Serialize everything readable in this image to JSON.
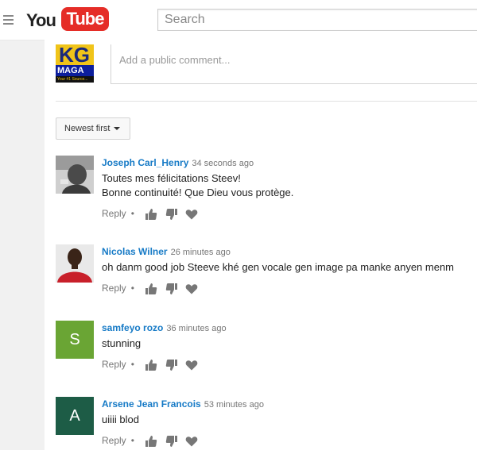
{
  "header": {
    "logo_you": "You",
    "logo_tube": "Tube",
    "search_placeholder": "Search"
  },
  "compose": {
    "avatar_big": "KG",
    "avatar_mid": "MAGA",
    "avatar_tag": "Your #1 Source...",
    "placeholder": "Add a public comment..."
  },
  "sort": {
    "label": "Newest first"
  },
  "comments": [
    {
      "author": "Joseph Carl_Henry",
      "time": "34 seconds ago",
      "text_line1": "Toutes mes félicitations Steev!",
      "text_line2": "Bonne continuité! Que Dieu vous protège.",
      "reply": "Reply",
      "avatar_color": "#9a9a9a"
    },
    {
      "author": "Nicolas Wilner",
      "time": "26 minutes ago",
      "text_line1": "oh danm good job Steeve khé gen vocale gen image pa manke anyen menm",
      "reply": "Reply",
      "avatar_color": "#c8202a"
    },
    {
      "author": "samfeyo rozo",
      "time": "36 minutes ago",
      "text_line1": "stunning",
      "reply": "Reply",
      "avatar_letter": "S",
      "avatar_color": "#6aa534"
    },
    {
      "author": "Arsene Jean Francois",
      "time": "53 minutes ago",
      "text_line1": "uiiii blod",
      "reply": "Reply",
      "avatar_letter": "A",
      "avatar_color": "#1d5c46"
    }
  ],
  "icons": {
    "like": "thumbs-up-icon",
    "dislike": "thumbs-down-icon",
    "heart": "heart-icon"
  },
  "colors": {
    "brand_red": "#e52d27",
    "author_link": "#167ac6"
  }
}
